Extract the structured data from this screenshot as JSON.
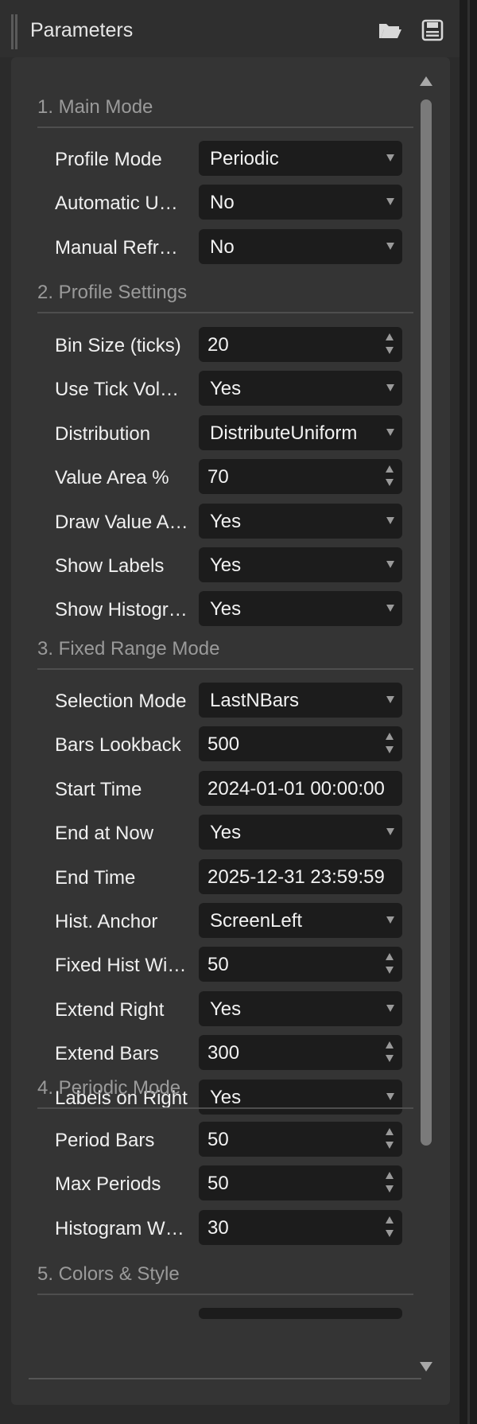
{
  "window": {
    "title": "Parameters"
  },
  "titlebar_icons": [
    "open-folder-icon",
    "save-icon"
  ],
  "sections": [
    {
      "title": "1. Main Mode",
      "rows": [
        {
          "label": "Profile Mode",
          "value": "Periodic",
          "kind": "dropdown"
        },
        {
          "label": "Automatic Update",
          "value": "No",
          "kind": "dropdown"
        },
        {
          "label": "Manual Refresh",
          "value": "No",
          "kind": "dropdown"
        }
      ]
    },
    {
      "title": "2. Profile Settings",
      "rows": [
        {
          "label": "Bin Size (ticks)",
          "value": "20",
          "kind": "number"
        },
        {
          "label": "Use Tick Volume",
          "value": "Yes",
          "kind": "dropdown"
        },
        {
          "label": "Distribution",
          "value": "DistributeUniform",
          "kind": "dropdown"
        },
        {
          "label": "Value Area %",
          "value": "70",
          "kind": "number"
        },
        {
          "label": "Draw Value Area",
          "value": "Yes",
          "kind": "dropdown"
        },
        {
          "label": "Show Labels",
          "value": "Yes",
          "kind": "dropdown"
        },
        {
          "label": "Show Histogram",
          "value": "Yes",
          "kind": "dropdown"
        }
      ]
    },
    {
      "title": "3. Fixed Range Mode",
      "rows": [
        {
          "label": "Selection Mode",
          "value": "LastNBars",
          "kind": "dropdown"
        },
        {
          "label": "Bars Lookback",
          "value": "500",
          "kind": "number"
        },
        {
          "label": "Start Time",
          "value": "2024-01-01 00:00:00",
          "kind": "text"
        },
        {
          "label": "End at Now",
          "value": "Yes",
          "kind": "dropdown"
        },
        {
          "label": "End Time",
          "value": "2025-12-31 23:59:59",
          "kind": "text"
        },
        {
          "label": "Hist. Anchor",
          "value": "ScreenLeft",
          "kind": "dropdown"
        },
        {
          "label": "Fixed Hist Width",
          "value": "50",
          "kind": "number"
        },
        {
          "label": "Extend Right",
          "value": "Yes",
          "kind": "dropdown"
        },
        {
          "label": "Extend Bars",
          "value": "300",
          "kind": "number"
        },
        {
          "label": "Labels on Right",
          "value": "Yes",
          "kind": "dropdown"
        }
      ]
    },
    {
      "title": "4. Periodic Mode",
      "rows": [
        {
          "label": "Period Bars",
          "value": "50",
          "kind": "number"
        },
        {
          "label": "Max Periods",
          "value": "50",
          "kind": "number"
        },
        {
          "label": "Histogram Width",
          "value": "30",
          "kind": "number"
        }
      ]
    },
    {
      "title": "5. Colors & Style",
      "rows": []
    }
  ]
}
